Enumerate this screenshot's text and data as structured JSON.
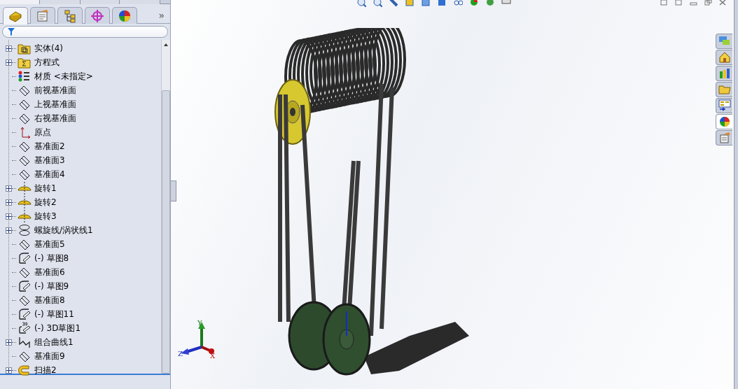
{
  "panel_tabs": [
    {
      "kind": "feature",
      "selected": true
    },
    {
      "kind": "property",
      "selected": false
    },
    {
      "kind": "config",
      "selected": false
    },
    {
      "kind": "dimxpert",
      "selected": false
    },
    {
      "kind": "display",
      "selected": false
    }
  ],
  "expand_glyph": "»",
  "tree": [
    {
      "label": "实体(4)",
      "kind": "folder-body",
      "expandable": true
    },
    {
      "label": "方程式",
      "kind": "folder-equation",
      "expandable": true
    },
    {
      "label": "材质 <未指定>",
      "kind": "material",
      "expandable": false
    },
    {
      "label": "前视基准面",
      "kind": "plane",
      "expandable": false
    },
    {
      "label": "上视基准面",
      "kind": "plane",
      "expandable": false
    },
    {
      "label": "右视基准面",
      "kind": "plane",
      "expandable": false
    },
    {
      "label": "原点",
      "kind": "origin",
      "expandable": false
    },
    {
      "label": "基准面2",
      "kind": "plane",
      "expandable": false
    },
    {
      "label": "基准面3",
      "kind": "plane",
      "expandable": false
    },
    {
      "label": "基准面4",
      "kind": "plane",
      "expandable": false
    },
    {
      "label": "旋转1",
      "kind": "revolve",
      "expandable": true
    },
    {
      "label": "旋转2",
      "kind": "revolve",
      "expandable": true
    },
    {
      "label": "旋转3",
      "kind": "revolve",
      "expandable": true
    },
    {
      "label": "螺旋线/涡状线1",
      "kind": "helix",
      "expandable": true
    },
    {
      "label": "基准面5",
      "kind": "plane",
      "expandable": false
    },
    {
      "label": "(-) 草图8",
      "kind": "sketch",
      "expandable": false
    },
    {
      "label": "基准面6",
      "kind": "plane",
      "expandable": false
    },
    {
      "label": "(-) 草图9",
      "kind": "sketch",
      "expandable": false
    },
    {
      "label": "基准面8",
      "kind": "plane",
      "expandable": false
    },
    {
      "label": "(-) 草图11",
      "kind": "sketch",
      "expandable": false
    },
    {
      "label": "(-) 3D草图1",
      "kind": "sketch3d",
      "expandable": false
    },
    {
      "label": "组合曲线1",
      "kind": "curve",
      "expandable": true
    },
    {
      "label": "基准面9",
      "kind": "plane",
      "expandable": false
    },
    {
      "label": "扫描2",
      "kind": "sweep",
      "expandable": true
    }
  ],
  "task_pane": [
    {
      "kind": "resources",
      "selected": false
    },
    {
      "kind": "home",
      "selected": false
    },
    {
      "kind": "library",
      "selected": false
    },
    {
      "kind": "explorer",
      "selected": false
    },
    {
      "kind": "palette",
      "selected": false
    },
    {
      "kind": "appearance",
      "selected": true
    },
    {
      "kind": "custom",
      "selected": false
    }
  ],
  "triad": {
    "x": "X",
    "y": "Y",
    "z": "Z"
  }
}
